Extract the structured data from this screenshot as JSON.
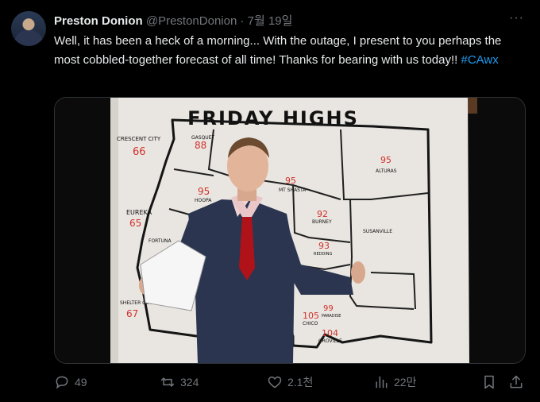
{
  "tweet": {
    "author_name": "Preston Donion",
    "handle": "@PrestonDonion",
    "separator": "·",
    "date": "7월 19일",
    "more": "···",
    "text": "Well, it has been a heck of a morning... With the outage, I present to you perhaps the most cobbled-together forecast of all time! Thanks for bearing with us today!! ",
    "hashtag": "#CAwx"
  },
  "media": {
    "board_title": "FRIDAY HIGHS",
    "cities": [
      {
        "name": "CRESCENT CITY",
        "temp": "66"
      },
      {
        "name": "GASQUET",
        "temp": "88"
      },
      {
        "name": "HOOPA",
        "temp": "95"
      },
      {
        "name": "MT SHASTA",
        "temp": "95"
      },
      {
        "name": "ALTURAS",
        "temp": "95"
      },
      {
        "name": "EUREKA",
        "temp": "65"
      },
      {
        "name": "FORTUNA",
        "temp": ""
      },
      {
        "name": "BURNEY",
        "temp": "92"
      },
      {
        "name": "SUSANVILLE",
        "temp": ""
      },
      {
        "name": "REDDING",
        "temp": "93"
      },
      {
        "name": "SHELTER COVE",
        "temp": "67"
      },
      {
        "name": "PARADISE",
        "temp": "99"
      },
      {
        "name": "CHICO",
        "temp": "105"
      },
      {
        "name": "OROVILLE",
        "temp": "104"
      }
    ]
  },
  "actions": {
    "replies": "49",
    "reposts": "324",
    "likes": "2.1천",
    "views": "22만"
  },
  "colors": {
    "accent": "#1d9bf0",
    "muted": "#71767b",
    "marker_red": "#d2302a"
  }
}
